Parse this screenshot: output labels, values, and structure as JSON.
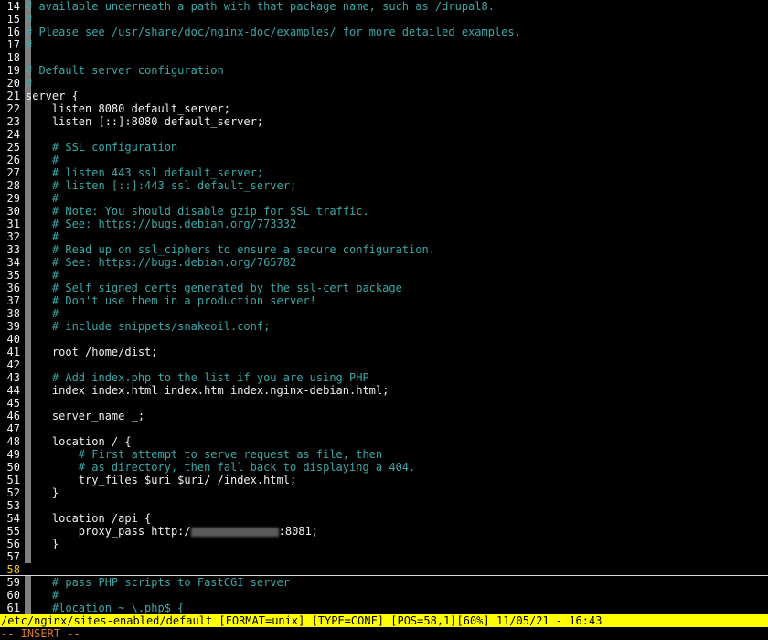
{
  "editor": {
    "lines": [
      {
        "num": "14",
        "kind": "comment",
        "text": "# available underneath a path with that package name, such as /drupal8."
      },
      {
        "num": "15",
        "kind": "comment",
        "text": "#"
      },
      {
        "num": "16",
        "kind": "comment",
        "text": "# Please see /usr/share/doc/nginx-doc/examples/ for more detailed examples."
      },
      {
        "num": "17",
        "kind": "comment",
        "text": "#"
      },
      {
        "num": "18",
        "kind": "blank",
        "text": ""
      },
      {
        "num": "19",
        "kind": "comment",
        "text": "# Default server configuration"
      },
      {
        "num": "20",
        "kind": "comment",
        "text": "#"
      },
      {
        "num": "21",
        "kind": "code",
        "text": "server {"
      },
      {
        "num": "22",
        "kind": "code",
        "text": "    listen 8080 default_server;"
      },
      {
        "num": "23",
        "kind": "code",
        "text": "    listen [::]:8080 default_server;"
      },
      {
        "num": "24",
        "kind": "blank",
        "text": ""
      },
      {
        "num": "25",
        "kind": "comment",
        "text": "    # SSL configuration"
      },
      {
        "num": "26",
        "kind": "comment",
        "text": "    #"
      },
      {
        "num": "27",
        "kind": "comment",
        "text": "    # listen 443 ssl default_server;"
      },
      {
        "num": "28",
        "kind": "comment",
        "text": "    # listen [::]:443 ssl default_server;"
      },
      {
        "num": "29",
        "kind": "comment",
        "text": "    #"
      },
      {
        "num": "30",
        "kind": "comment",
        "text": "    # Note: You should disable gzip for SSL traffic."
      },
      {
        "num": "31",
        "kind": "comment",
        "text": "    # See: https://bugs.debian.org/773332"
      },
      {
        "num": "32",
        "kind": "comment",
        "text": "    #"
      },
      {
        "num": "33",
        "kind": "comment",
        "text": "    # Read up on ssl_ciphers to ensure a secure configuration."
      },
      {
        "num": "34",
        "kind": "comment",
        "text": "    # See: https://bugs.debian.org/765782"
      },
      {
        "num": "35",
        "kind": "comment",
        "text": "    #"
      },
      {
        "num": "36",
        "kind": "comment",
        "text": "    # Self signed certs generated by the ssl-cert package"
      },
      {
        "num": "37",
        "kind": "comment",
        "text": "    # Don't use them in a production server!"
      },
      {
        "num": "38",
        "kind": "comment",
        "text": "    #"
      },
      {
        "num": "39",
        "kind": "comment",
        "text": "    # include snippets/snakeoil.conf;"
      },
      {
        "num": "40",
        "kind": "blank",
        "text": ""
      },
      {
        "num": "41",
        "kind": "code",
        "text": "    root /home/dist;"
      },
      {
        "num": "42",
        "kind": "blank",
        "text": ""
      },
      {
        "num": "43",
        "kind": "comment",
        "text": "    # Add index.php to the list if you are using PHP"
      },
      {
        "num": "44",
        "kind": "code",
        "text": "    index index.html index.htm index.nginx-debian.html;"
      },
      {
        "num": "45",
        "kind": "blank",
        "text": ""
      },
      {
        "num": "46",
        "kind": "code",
        "text": "    server_name _;"
      },
      {
        "num": "47",
        "kind": "blank",
        "text": ""
      },
      {
        "num": "48",
        "kind": "code",
        "text": "    location / {"
      },
      {
        "num": "49",
        "kind": "comment",
        "text": "        # First attempt to serve request as file, then"
      },
      {
        "num": "50",
        "kind": "comment",
        "text": "        # as directory, then fall back to displaying a 404."
      },
      {
        "num": "51",
        "kind": "code",
        "text": "        try_files $uri $uri/ /index.html;"
      },
      {
        "num": "52",
        "kind": "code",
        "text": "    }"
      },
      {
        "num": "53",
        "kind": "blank",
        "text": ""
      },
      {
        "num": "54",
        "kind": "code",
        "text": "    location /api {"
      },
      {
        "num": "55",
        "kind": "code",
        "text": "        proxy_pass http:/",
        "suffix": ":8081;",
        "redacted": true
      },
      {
        "num": "56",
        "kind": "code",
        "text": "    }"
      },
      {
        "num": "57",
        "kind": "blank",
        "text": ""
      },
      {
        "num": "58",
        "kind": "blank",
        "text": "",
        "cursor": true
      },
      {
        "num": "59",
        "kind": "comment",
        "text": "    # pass PHP scripts to FastCGI server"
      },
      {
        "num": "60",
        "kind": "comment",
        "text": "    #"
      },
      {
        "num": "61",
        "kind": "comment",
        "text": "    #location ~ \\.php$ {"
      }
    ]
  },
  "statusline": {
    "text": "/etc/nginx/sites-enabled/default [FORMAT=unix] [TYPE=CONF] [POS=58,1][60%] 11/05/21 - 16:43"
  },
  "modeline": {
    "text": "-- INSERT --"
  },
  "colors": {
    "background": "#000000",
    "comment": "#3aa7a7",
    "code": "#f0f0f0",
    "statusline_bg": "#ffff00",
    "mode_text": "#d47a2a"
  }
}
